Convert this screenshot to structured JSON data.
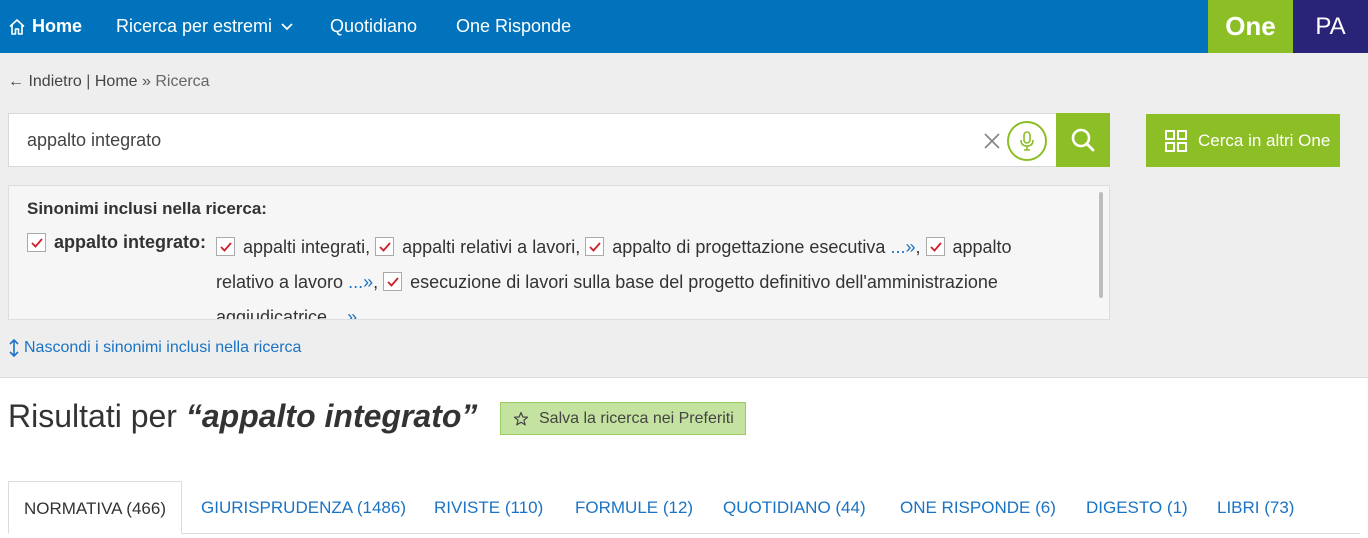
{
  "nav": {
    "home": "Home",
    "ricerca": "Ricerca per estremi",
    "quotidiano": "Quotidiano",
    "one_risponde": "One Risponde",
    "brand_one": "One",
    "brand_pa": "PA"
  },
  "breadcrumb": {
    "back": "← Indietro",
    "sep1": " | ",
    "home": "Home",
    "sep2": " » ",
    "current": "Ricerca"
  },
  "search": {
    "value": "appalto integrato",
    "altri_label": "Cerca in altri One"
  },
  "synonyms": {
    "title": "Sinonimi inclusi nella ricerca:",
    "main_term": "appalto integrato:",
    "items": [
      {
        "text": "appalti integrati",
        "more": "",
        "sep": ","
      },
      {
        "text": "appalti relativi a lavori",
        "more": "",
        "sep": ","
      },
      {
        "text": "appalto di progettazione esecutiva",
        "more": "...»",
        "sep": ","
      },
      {
        "text": "appalto relativo a lavoro",
        "more": "...»",
        "sep": ","
      },
      {
        "text": "esecuzione di lavori sulla base del progetto definitivo dell'amministrazione aggiudicatrice",
        "more": "...»",
        "sep": ""
      }
    ],
    "hide_label": "Nascondi i sinonimi inclusi nella ricerca"
  },
  "results": {
    "prefix": "Risultati per ",
    "query": "“appalto integrato”",
    "save_label": "Salva la ricerca nei Preferiti"
  },
  "tabs": [
    {
      "label": "NORMATIVA (466)"
    },
    {
      "label": "GIURISPRUDENZA (1486)"
    },
    {
      "label": "RIVISTE (110)"
    },
    {
      "label": "FORMULE (12)"
    },
    {
      "label": "QUOTIDIANO (44)"
    },
    {
      "label": "ONE RISPONDE (6)"
    },
    {
      "label": "DIGESTO (1)"
    },
    {
      "label": "LIBRI (73)"
    }
  ],
  "colors": {
    "nav_blue": "#0073bc",
    "brand_green": "#8cbe26",
    "brand_navy": "#2a2478",
    "link_blue": "#1a73c4",
    "check_red": "#d0202a"
  }
}
